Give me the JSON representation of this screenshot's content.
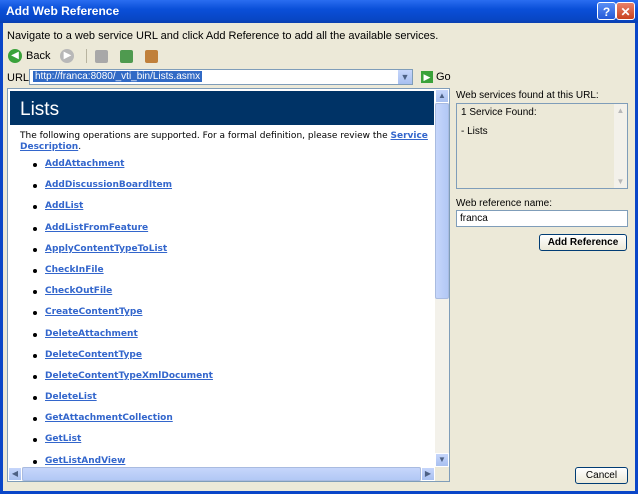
{
  "window": {
    "title": "Add Web Reference",
    "help_glyph": "?",
    "close_glyph": "✕"
  },
  "instructions": "Navigate to a web service URL and click Add Reference to add all the available services.",
  "toolbar": {
    "back_label": "Back",
    "icons": [
      "back-icon",
      "forward-icon",
      "stop-icon",
      "refresh-icon",
      "home-icon"
    ]
  },
  "url": {
    "label": "URL:",
    "value": "http://franca:8080/_vti_bin/Lists.asmx",
    "go_label": "Go"
  },
  "browser": {
    "heading": "Lists",
    "intro_text": "The following operations are supported. For a formal definition, please review the ",
    "intro_link": "Service Description",
    "intro_end": ".",
    "operations": [
      "AddAttachment",
      "AddDiscussionBoardItem",
      "AddList",
      "AddListFromFeature",
      "ApplyContentTypeToList",
      "CheckInFile",
      "CheckOutFile",
      "CreateContentType",
      "DeleteAttachment",
      "DeleteContentType",
      "DeleteContentTypeXmlDocument",
      "DeleteList",
      "GetAttachmentCollection",
      "GetList",
      "GetListAndView"
    ]
  },
  "right_panel": {
    "services_label": "Web services found at this URL:",
    "services_found": "1 Service Found:",
    "service_item": "- Lists",
    "ref_name_label": "Web reference name:",
    "ref_name_value": "franca",
    "add_reference": "Add Reference",
    "cancel": "Cancel"
  },
  "colors": {
    "title_bar": "#0a4fd8",
    "banner": "#003366",
    "link": "#3366cc",
    "dialog_bg": "#ece9d8"
  }
}
